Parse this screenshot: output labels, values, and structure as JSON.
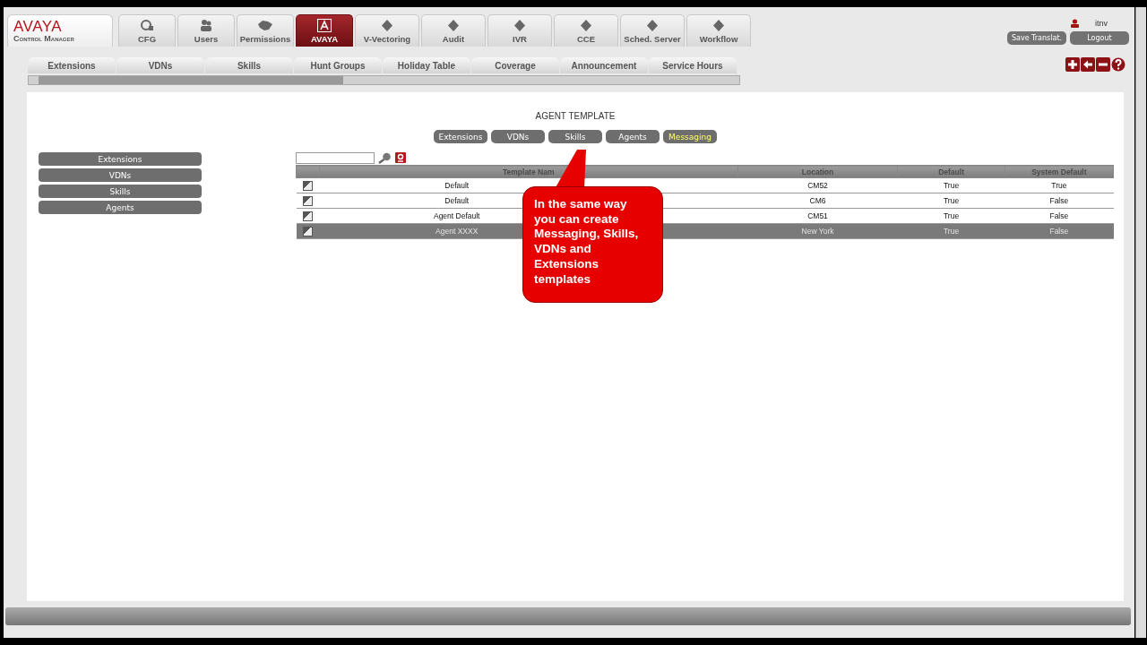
{
  "logo": {
    "brand": "AVAYA",
    "product": "Control Manager"
  },
  "main_tabs": [
    {
      "label": "CFG",
      "selected": false
    },
    {
      "label": "Users",
      "selected": false
    },
    {
      "label": "Permissions",
      "selected": false
    },
    {
      "label": "AVAYA",
      "selected": true
    },
    {
      "label": "V-Vectoring",
      "selected": false
    },
    {
      "label": "Audit",
      "selected": false
    },
    {
      "label": "IVR",
      "selected": false
    },
    {
      "label": "CCE",
      "selected": false
    },
    {
      "label": "Sched. Server",
      "selected": false
    },
    {
      "label": "Workflow",
      "selected": false
    }
  ],
  "user": {
    "name": "itnv"
  },
  "header_buttons": [
    "Save Translat.",
    "Logout"
  ],
  "sub_tabs": [
    "Extensions",
    "VDNs",
    "Skills",
    "Hunt Groups",
    "Holiday Table",
    "Coverage",
    "Announcement",
    "Service Hours"
  ],
  "page_title": "AGENT TEMPLATE",
  "template_types": [
    {
      "label": "Extensions",
      "selected": false
    },
    {
      "label": "VDNs",
      "selected": false
    },
    {
      "label": "Skills",
      "selected": false
    },
    {
      "label": "Agents",
      "selected": false
    },
    {
      "label": "Messaging",
      "selected": true
    }
  ],
  "sidebar": {
    "items": [
      "Extensions",
      "VDNs",
      "Skills",
      "Agents"
    ]
  },
  "table": {
    "columns": [
      "Template Nam",
      "Location",
      "Default",
      "System Default"
    ],
    "rows": [
      {
        "cells": [
          "Default",
          "CM52",
          "True",
          "True"
        ],
        "selected": false
      },
      {
        "cells": [
          "Default",
          "CM6",
          "True",
          "False"
        ],
        "selected": false
      },
      {
        "cells": [
          "Agent Default",
          "CM51",
          "True",
          "False"
        ],
        "selected": false
      },
      {
        "cells": [
          "Agent XXXX",
          "New York",
          "True",
          "False"
        ],
        "selected": true
      }
    ]
  },
  "callout": "In the same way you can create Messaging, Skills, VDNs and Extensions templates"
}
